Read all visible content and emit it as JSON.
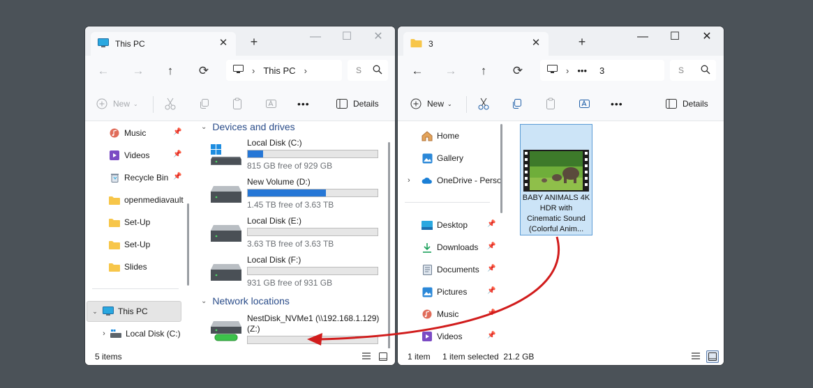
{
  "left_window": {
    "tab_title": "This PC",
    "address": {
      "segment": "This PC"
    },
    "search": {
      "placeholder": "S"
    },
    "toolbar": {
      "new_label": "New",
      "more": "•••",
      "details_label": "Details"
    },
    "nav_items": [
      {
        "label": "Music",
        "icon": "music-icon",
        "pinned": true
      },
      {
        "label": "Videos",
        "icon": "videos-icon",
        "pinned": true
      },
      {
        "label": "Recycle Bin",
        "icon": "recycle-bin-icon",
        "pinned": true
      },
      {
        "label": "openmediavault",
        "icon": "folder-icon",
        "pinned": false
      },
      {
        "label": "Set-Up",
        "icon": "folder-icon",
        "pinned": false
      },
      {
        "label": "Set-Up",
        "icon": "folder-icon",
        "pinned": false
      },
      {
        "label": "Slides",
        "icon": "folder-icon",
        "pinned": false
      }
    ],
    "this_pc_label": "This PC",
    "local_disk_label": "Local Disk (C:)",
    "groups": {
      "devices": "Devices and drives",
      "network": "Network locations"
    },
    "drives": [
      {
        "name": "Local Disk (C:)",
        "free": "815 GB free of 929 GB",
        "used_fraction": 0.12,
        "icon": "windows-drive-icon"
      },
      {
        "name": "New Volume (D:)",
        "free": "1.45 TB free of 3.63 TB",
        "used_fraction": 0.6,
        "icon": "hard-drive-icon"
      },
      {
        "name": "Local Disk (E:)",
        "free": "3.63 TB free of 3.63 TB",
        "used_fraction": 0.0,
        "icon": "hard-drive-icon"
      },
      {
        "name": "Local Disk (F:)",
        "free": "931 GB free of 931 GB",
        "used_fraction": 0.0,
        "icon": "hard-drive-icon"
      }
    ],
    "network_drive": {
      "name_line1": "NestDisk_NVMe1 (\\\\192.168.1.129)",
      "name_line2": "(Z:)",
      "used_fraction": 0.0,
      "icon": "network-drive-icon"
    },
    "status": {
      "items": "5 items"
    }
  },
  "right_window": {
    "tab_title": "3",
    "address": {
      "ellipsis": "•••",
      "segment": "3"
    },
    "search": {
      "placeholder": "S"
    },
    "toolbar": {
      "new_label": "New",
      "more": "•••",
      "details_label": "Details"
    },
    "nav_top": [
      {
        "label": "Home",
        "icon": "home-icon"
      },
      {
        "label": "Gallery",
        "icon": "gallery-icon"
      },
      {
        "label": "OneDrive - Perso",
        "icon": "onedrive-icon"
      }
    ],
    "nav_pinned": [
      {
        "label": "Desktop",
        "icon": "desktop-icon"
      },
      {
        "label": "Downloads",
        "icon": "downloads-icon"
      },
      {
        "label": "Documents",
        "icon": "documents-icon"
      },
      {
        "label": "Pictures",
        "icon": "pictures-icon"
      },
      {
        "label": "Music",
        "icon": "music-icon"
      },
      {
        "label": "Videos",
        "icon": "videos-icon"
      }
    ],
    "file": {
      "label": "BABY ANIMALS 4K HDR  with Cinematic Sound (Colorful Anim...",
      "icon": "video-thumbnail"
    },
    "status": {
      "items": "1 item",
      "selected": "1 item selected  21.2 GB"
    }
  },
  "colors": {
    "accent": "#2677d6",
    "selection": "#cce4f7",
    "arrow": "#d11c1c",
    "folder": "#f7c64a",
    "desktop_bg": "#4b5258"
  }
}
